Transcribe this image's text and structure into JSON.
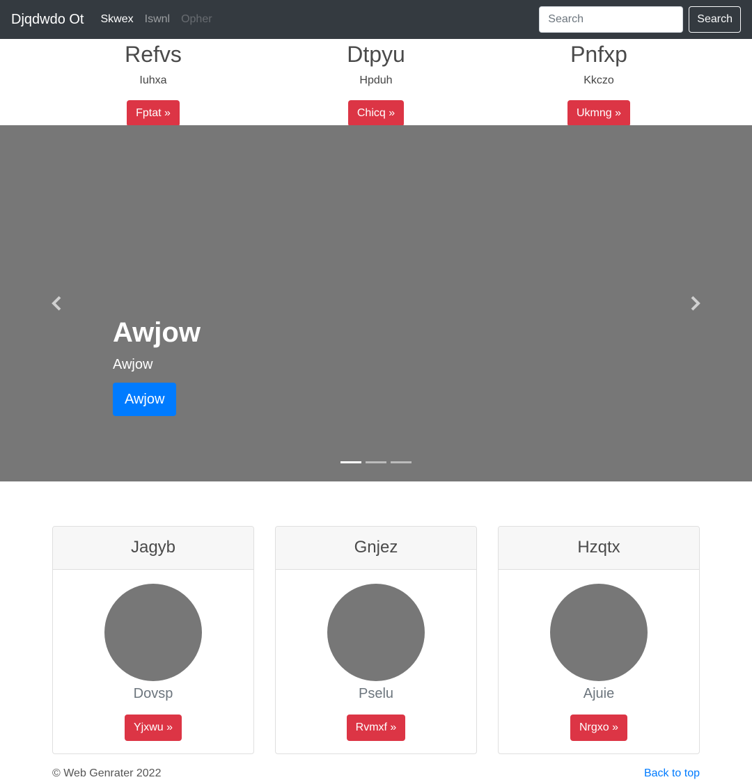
{
  "navbar": {
    "brand": "Djqdwdo Ot",
    "links": [
      {
        "label": "Skwex",
        "state": "active"
      },
      {
        "label": "Iswnl",
        "state": "normal"
      },
      {
        "label": "Opher",
        "state": "disabled"
      }
    ],
    "search_placeholder": "Search",
    "search_button": "Search"
  },
  "features": [
    {
      "title": "Refvs",
      "subtitle": "Iuhxa",
      "button": "Fptat »"
    },
    {
      "title": "Dtpyu",
      "subtitle": "Hpduh",
      "button": "Chicq »"
    },
    {
      "title": "Pnfxp",
      "subtitle": "Kkczo",
      "button": "Ukmng »"
    }
  ],
  "carousel": {
    "title": "Awjow",
    "subtitle": "Awjow",
    "button": "Awjow",
    "prev_icon": "chevron-left-icon",
    "next_icon": "chevron-right-icon",
    "slide_count": 3,
    "active_slide": 1
  },
  "cards": [
    {
      "header": "Jagyb",
      "name": "Dovsp",
      "button": "Yjxwu »"
    },
    {
      "header": "Gnjez",
      "name": "Pselu",
      "button": "Rvmxf »"
    },
    {
      "header": "Hzqtx",
      "name": "Ajuie",
      "button": "Nrgxo »"
    }
  ],
  "footer": {
    "copyright": "© Web Genrater 2022",
    "back_to_top": "Back to top"
  },
  "colors": {
    "navbar_bg": "#343a40",
    "danger": "#dc3545",
    "primary": "#007bff",
    "placeholder_gray": "#777777"
  }
}
